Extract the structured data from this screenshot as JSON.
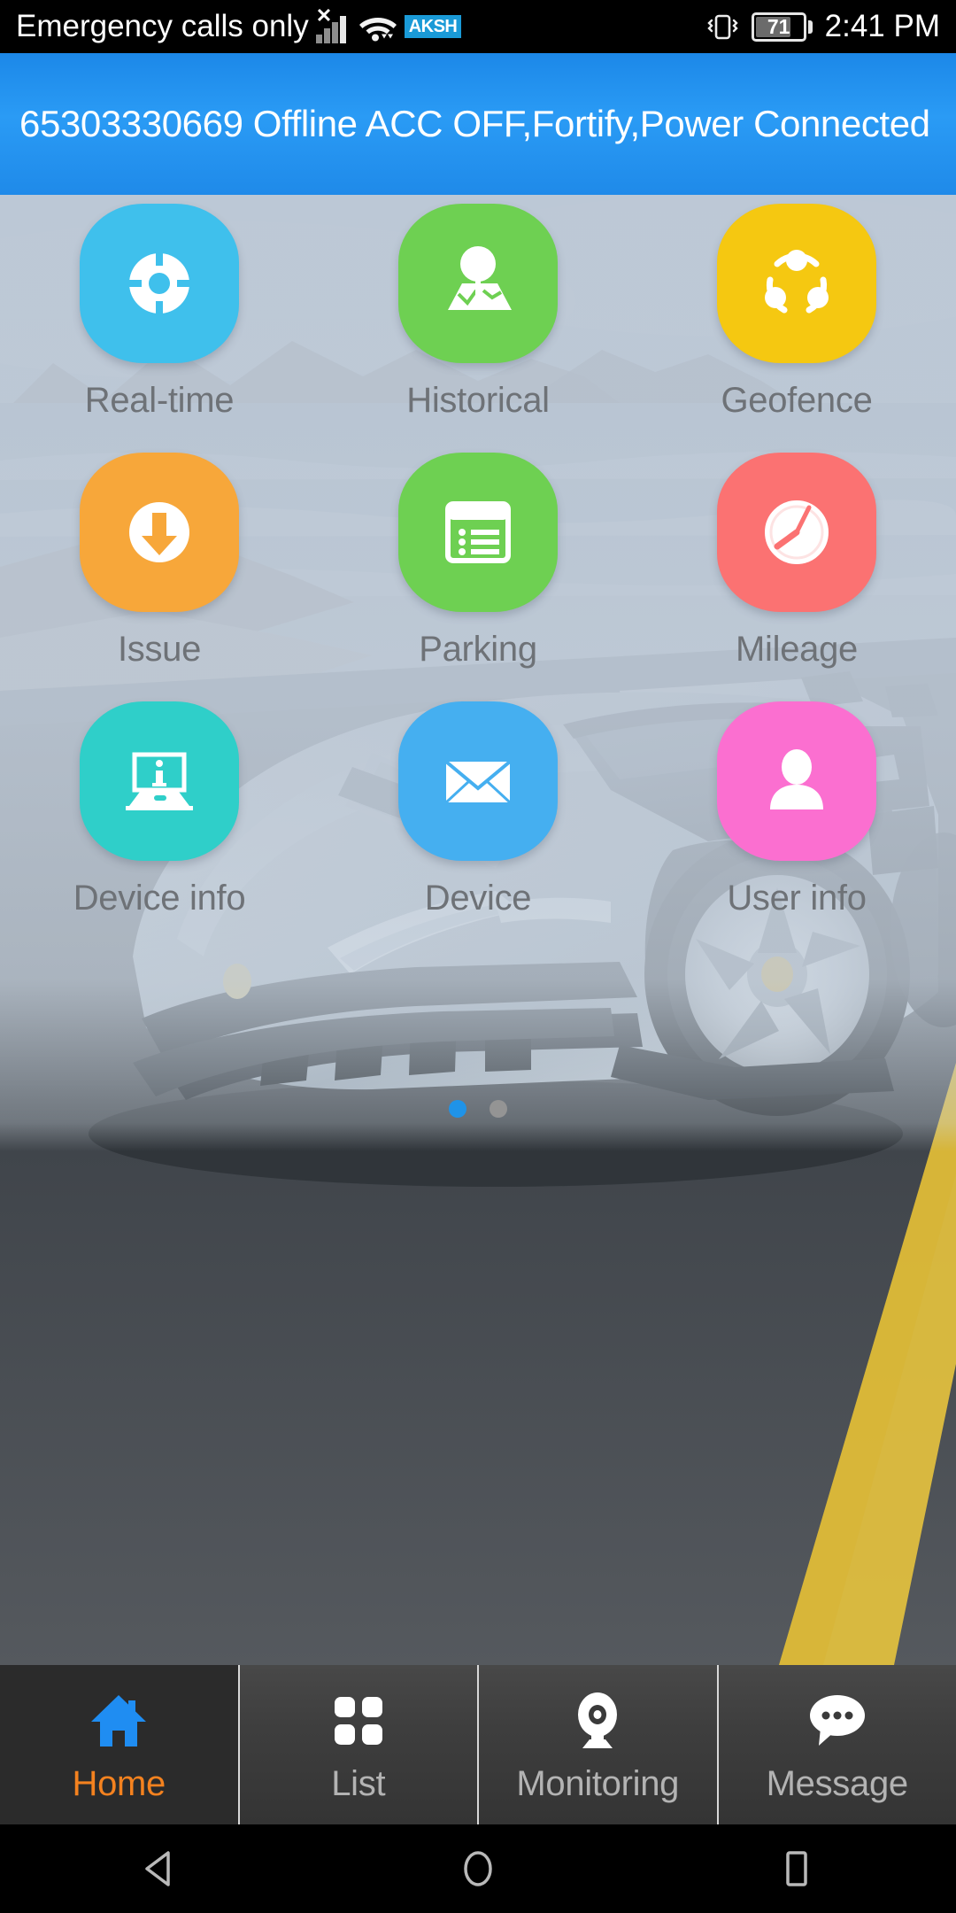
{
  "status_bar": {
    "carrier": "Emergency calls only",
    "signal_icon": "signal-bars-no-service-icon",
    "wifi_icon": "wifi-icon",
    "hotspot_badge": "AKSH",
    "vibrate_icon": "vibrate-icon",
    "battery_percent": "71",
    "battery_icon": "battery-icon",
    "clock": "2:41 PM"
  },
  "banner": {
    "text": "65303330669 Offline ACC OFF,Fortify,Power Connected",
    "background_color": "#2a9bf5",
    "text_color": "#ffffff"
  },
  "grid": {
    "items": [
      {
        "label": "Real-time",
        "icon": "crosshair-target-icon",
        "color": "#3fc0ec"
      },
      {
        "label": "Historical",
        "icon": "map-pin-icon",
        "color": "#6ed052"
      },
      {
        "label": "Geofence",
        "icon": "geofence-nodes-icon",
        "color": "#f5c811"
      },
      {
        "label": "Issue",
        "icon": "download-arrow-icon",
        "color": "#f7a73a"
      },
      {
        "label": "Parking",
        "icon": "list-note-icon",
        "color": "#6ed052"
      },
      {
        "label": "Mileage",
        "icon": "gauge-clock-icon",
        "color": "#fb7272"
      },
      {
        "label": "Device info",
        "icon": "laptop-info-icon",
        "color": "#2fcfc9"
      },
      {
        "label": "Device",
        "icon": "envelope-icon",
        "color": "#45aff0"
      },
      {
        "label": "User info",
        "icon": "person-icon",
        "color": "#fb6fd0"
      }
    ]
  },
  "pager": {
    "total_pages": 2,
    "current_page": 1,
    "active_color": "#1f93e8",
    "inactive_color": "#949494"
  },
  "tab_bar": {
    "active_color": "#f4821f",
    "items": [
      {
        "label": "Home",
        "icon": "home-icon",
        "active": true
      },
      {
        "label": "List",
        "icon": "grid-squares-icon",
        "active": false
      },
      {
        "label": "Monitoring",
        "icon": "camera-icon",
        "active": false
      },
      {
        "label": "Message",
        "icon": "chat-bubble-icon",
        "active": false
      }
    ]
  },
  "android_nav": {
    "back": "back-triangle-icon",
    "home": "home-circle-icon",
    "recents": "recents-square-icon"
  },
  "wallpaper": {
    "description": "silver sports car on coastal road"
  }
}
